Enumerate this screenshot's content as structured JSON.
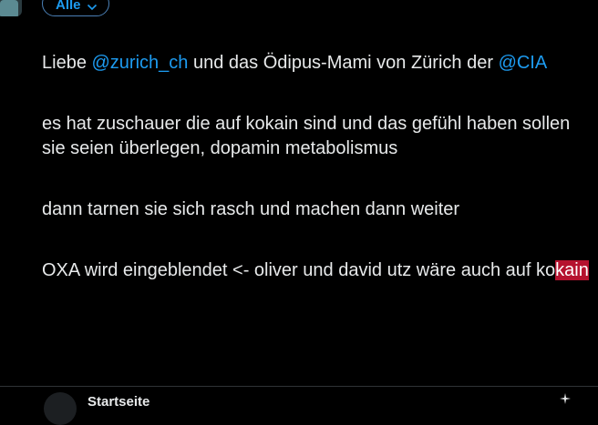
{
  "header": {
    "audience_label": "Alle"
  },
  "tweet": {
    "p1_prefix": "Liebe ",
    "p1_mention1": "@zurich_ch",
    "p1_middle": " und das Ödipus-Mami von Zürich der ",
    "p1_mention2": "@CIA",
    "p2": "es hat zuschauer die auf kokain sind und das gefühl haben sollen sie seien überlegen, dopamin metabolismus",
    "p3": "dann tarnen sie sich rasch und machen dann weiter",
    "p4_prefix": "OXA wird eingeblendet <- oliver und david utz wäre auch auf ko",
    "p4_highlight": "kain"
  },
  "bottom": {
    "label": "Startseite"
  },
  "colors": {
    "background": "#000000",
    "text": "#e7e9ea",
    "accent": "#1d9bf0",
    "highlight": "#b5122f"
  }
}
